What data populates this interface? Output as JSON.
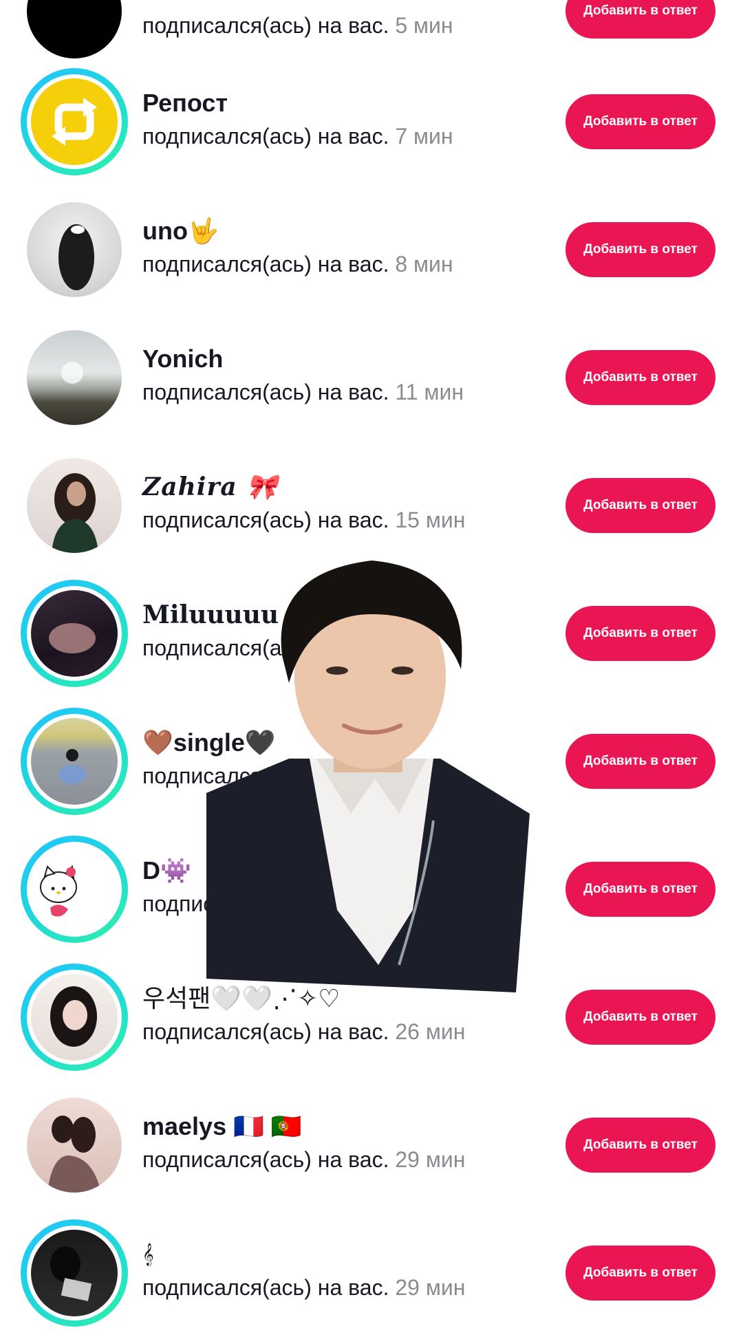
{
  "colors": {
    "accent": "#ea1553",
    "ring_gradient_start": "#22c3ff",
    "ring_gradient_end": "#2ef2a8",
    "time_gray": "#8a8b91"
  },
  "followers": [
    {
      "name": "",
      "subtitle": "подписался(ась) на вас.",
      "time": "5 мин",
      "button": "Добавить в ответ",
      "avatar_icon": "black-circle-avatar"
    },
    {
      "name": "Репост",
      "subtitle": "подписался(ась) на вас.",
      "time": "7 мин",
      "button": "Добавить в ответ",
      "avatar_icon": "repost-icon"
    },
    {
      "name": "uno🤟",
      "subtitle": "подписался(ась) на вас.",
      "time": "8 мин",
      "button": "Добавить в ответ",
      "avatar_icon": "photo-avatar"
    },
    {
      "name": "Yonich",
      "subtitle": "подписался(ась) на вас.",
      "time": "11 мин",
      "button": "Добавить в ответ",
      "avatar_icon": "photo-avatar"
    },
    {
      "name": "𝒁𝒂𝒉𝒊𝒓𝒂 🎀",
      "subtitle": "подписался(ась) на вас.",
      "time": "15 мин",
      "button": "Добавить в ответ",
      "avatar_icon": "photo-avatar"
    },
    {
      "name": "Miluuuuu",
      "subtitle": "подписался(ась) на вас.",
      "time": "",
      "button": "Добавить в ответ",
      "avatar_icon": "photo-avatar"
    },
    {
      "name": "🤎single🖤",
      "subtitle": "подписался(ась) на вас.",
      "time": "",
      "button": "Добавить в ответ",
      "avatar_icon": "photo-avatar"
    },
    {
      "name": "D👾",
      "subtitle": "подписался(ась) на вас.",
      "time": "",
      "button": "Добавить в ответ",
      "avatar_icon": "hello-kitty-avatar"
    },
    {
      "name": "우석팬🤍🤍⋰✧♡",
      "subtitle": "подписался(ась) на вас.",
      "time": "26 мин",
      "button": "Добавить в ответ",
      "avatar_icon": "photo-avatar"
    },
    {
      "name": "maelys 🇫🇷 🇵🇹",
      "subtitle": "подписался(ась) на вас.",
      "time": "29 мин",
      "button": "Добавить в ответ",
      "avatar_icon": "photo-avatar"
    },
    {
      "name": "𝄞",
      "subtitle": "подписался(ась) на вас.",
      "time": "29 мин",
      "button": "Добавить в ответ",
      "avatar_icon": "photo-avatar"
    }
  ]
}
